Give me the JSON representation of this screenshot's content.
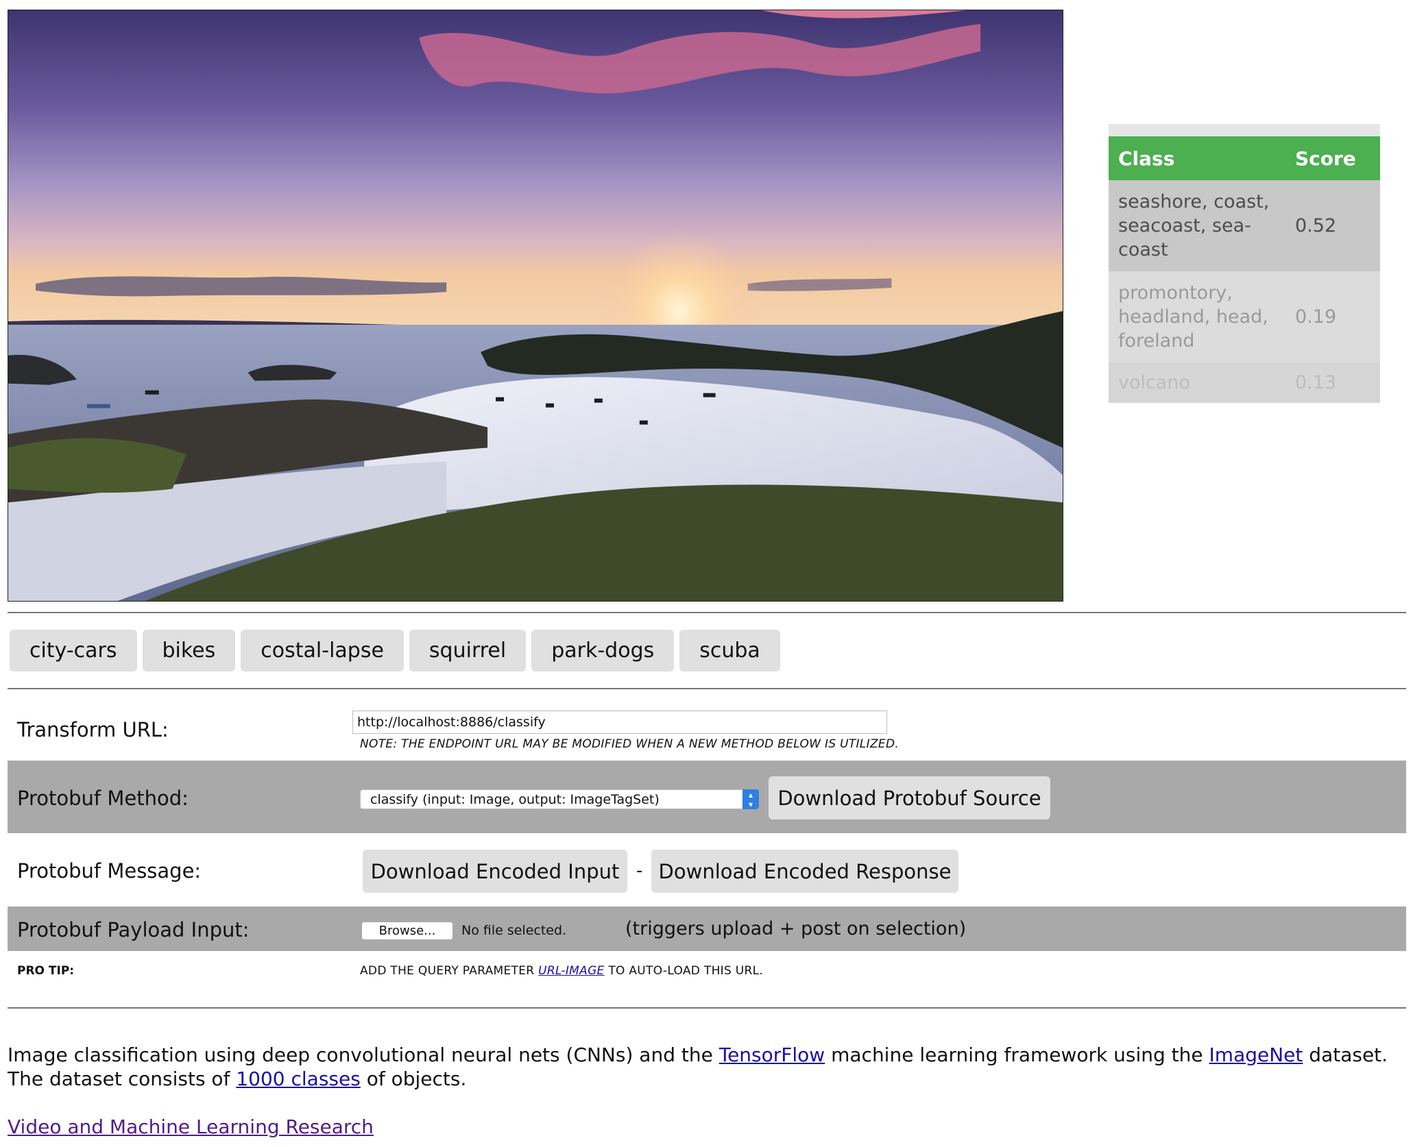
{
  "classification": {
    "header_class": "Class",
    "header_score": "Score",
    "rows": [
      {
        "label": "seashore, coast, seacoast, sea-coast",
        "score": "0.52"
      },
      {
        "label": "promontory, headland, head, foreland",
        "score": "0.19"
      },
      {
        "label": "volcano",
        "score": "0.13"
      }
    ]
  },
  "presets": [
    "city-cars",
    "bikes",
    "costal-lapse",
    "squirrel",
    "park-dogs",
    "scuba"
  ],
  "transform": {
    "label": "Transform URL:",
    "value": "http://localhost:8886/classify",
    "note": "NOTE: THE ENDPOINT URL MAY BE MODIFIED WHEN A NEW METHOD BELOW IS UTILIZED."
  },
  "method": {
    "label": "Protobuf Method:",
    "selected": "classify (input: Image, output: ImageTagSet)",
    "download_label": "Download Protobuf Source"
  },
  "message": {
    "label": "Protobuf Message:",
    "download_input": "Download Encoded Input",
    "separator": "-",
    "download_response": "Download Encoded Response"
  },
  "payload": {
    "label": "Protobuf Payload Input:",
    "browse": "Browse...",
    "no_file": "No file selected.",
    "hint": "(triggers upload + post on selection)"
  },
  "protip": {
    "label": "PRO TIP:",
    "before": "ADD THE QUERY PARAMETER",
    "param": "URL-IMAGE",
    "after": "TO AUTO-LOAD THIS URL."
  },
  "description": {
    "t1": "Image classification using deep convolutional neural nets (CNNs) and the",
    "link1": "TensorFlow",
    "t2": "machine learning framework using the",
    "link2": "ImageNet",
    "t3": "dataset. The dataset consists of",
    "link3": "1000 classes",
    "t4": "of objects."
  },
  "footer_link": "Video and Machine Learning Research"
}
